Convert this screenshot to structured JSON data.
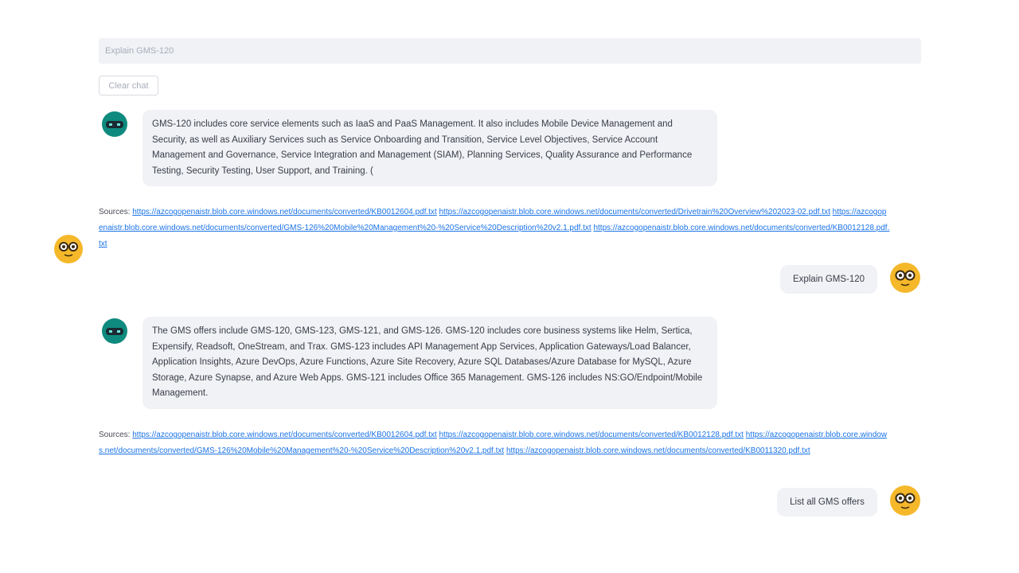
{
  "input": {
    "placeholder": "Explain GMS-120"
  },
  "clear_button": {
    "label": "Clear chat"
  },
  "messages": [
    {
      "role": "bot",
      "text": "GMS-120 includes core service elements such as IaaS and PaaS Management. It also includes Mobile Device Management and Security, as well as Auxiliary Services such as Service Onboarding and Transition, Service Level Objectives, Service Account Management and Governance, Service Integration and Management (SIAM), Planning Services, Quality Assurance and Performance Testing, Security Testing, User Support, and Training. (",
      "sources_label": "Sources:",
      "sources": [
        "https://azcogopenaistr.blob.core.windows.net/documents/converted/KB0012604.pdf.txt",
        "https://azcogopenaistr.blob.core.windows.net/documents/converted/Drivetrain%20Overview%202023-02.pdf.txt",
        "https://azcogopenaistr.blob.core.windows.net/documents/converted/GMS-126%20Mobile%20Management%20-%20Service%20Description%20v2.1.pdf.txt",
        "https://azcogopenaistr.blob.core.windows.net/documents/converted/KB0012128.pdf.txt"
      ]
    },
    {
      "role": "user",
      "text": "Explain GMS-120"
    },
    {
      "role": "bot",
      "text": "The GMS offers include GMS-120, GMS-123, GMS-121, and GMS-126. GMS-120 includes core business systems like Helm, Sertica, Expensify, Readsoft, OneStream, and Trax. GMS-123 includes API Management App Services, Application Gateways/Load Balancer, Application Insights, Azure DevOps, Azure Functions, Azure Site Recovery, Azure SQL Databases/Azure Database for MySQL, Azure Storage, Azure Synapse, and Azure Web Apps. GMS-121 includes Office 365 Management. GMS-126 includes NS:GO/Endpoint/Mobile Management.",
      "sources_label": "Sources:",
      "sources": [
        "https://azcogopenaistr.blob.core.windows.net/documents/converted/KB0012604.pdf.txt",
        "https://azcogopenaistr.blob.core.windows.net/documents/converted/KB0012128.pdf.txt",
        "https://azcogopenaistr.blob.core.windows.net/documents/converted/GMS-126%20Mobile%20Management%20-%20Service%20Description%20v2.1.pdf.txt",
        "https://azcogopenaistr.blob.core.windows.net/documents/converted/KB0011320.pdf.txt"
      ]
    },
    {
      "role": "user",
      "text": "List all GMS offers"
    }
  ],
  "icons": {
    "bot": "robot-avatar-icon",
    "user": "nerd-face-avatar-icon"
  },
  "colors": {
    "bubble": "#f0f2f6",
    "link": "#1a73e8",
    "bot_avatar": "#0f8a7e",
    "user_avatar": "#f5b82a"
  }
}
